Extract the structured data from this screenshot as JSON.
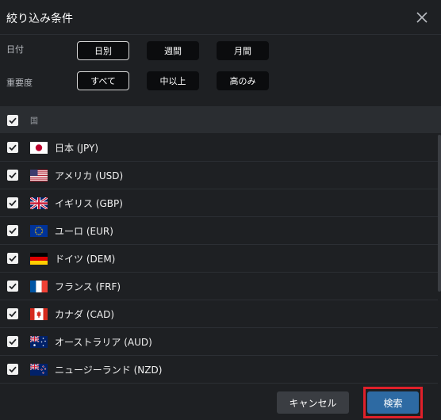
{
  "dialog": {
    "title": "絞り込み条件"
  },
  "filters": {
    "date": {
      "label": "日付",
      "options": [
        "日別",
        "週間",
        "月間"
      ],
      "selected": "日別"
    },
    "importance": {
      "label": "重要度",
      "options": [
        "すべて",
        "中以上",
        "高のみ"
      ],
      "selected": "すべて"
    }
  },
  "country_list": {
    "header_label": "国",
    "all_checked": true,
    "items": [
      {
        "label": "日本 (JPY)",
        "checked": true,
        "flag": "japan-flag"
      },
      {
        "label": "アメリカ (USD)",
        "checked": true,
        "flag": "usa-flag"
      },
      {
        "label": "イギリス (GBP)",
        "checked": true,
        "flag": "uk-flag"
      },
      {
        "label": "ユーロ (EUR)",
        "checked": true,
        "flag": "eu-flag"
      },
      {
        "label": "ドイツ (DEM)",
        "checked": true,
        "flag": "germany-flag"
      },
      {
        "label": "フランス (FRF)",
        "checked": true,
        "flag": "france-flag"
      },
      {
        "label": "カナダ (CAD)",
        "checked": true,
        "flag": "canada-flag"
      },
      {
        "label": "オーストラリア (AUD)",
        "checked": true,
        "flag": "australia-flag"
      },
      {
        "label": "ニュージーランド (NZD)",
        "checked": true,
        "flag": "new-zealand-flag"
      }
    ]
  },
  "footer": {
    "cancel_label": "キャンセル",
    "search_label": "検索"
  },
  "colors": {
    "background": "#1e2023",
    "chip": "#0b0c0e",
    "primary_button": "#2d6aa3",
    "highlight_border": "#e0202a"
  }
}
